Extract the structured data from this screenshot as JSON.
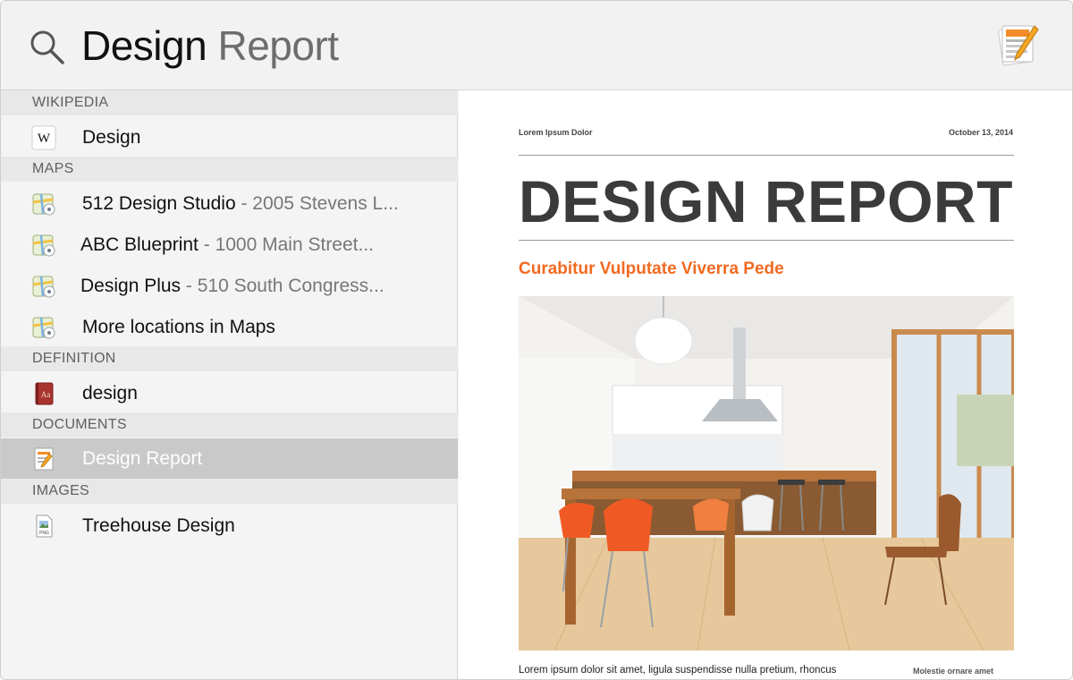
{
  "search": {
    "typed": "Design",
    "completion": " Report",
    "icon": "search-icon"
  },
  "app": {
    "icon": "pages-app-icon"
  },
  "sections": {
    "wikipedia": "WIKIPEDIA",
    "maps": "MAPS",
    "definition": "DEFINITION",
    "documents": "DOCUMENTS",
    "images": "IMAGES"
  },
  "results": {
    "wikipedia": [
      {
        "title": "Design",
        "subtitle": "",
        "icon": "wikipedia-icon"
      }
    ],
    "maps": [
      {
        "title": "512 Design Studio",
        "subtitle": " - 2005 Stevens L...",
        "icon": "maps-icon"
      },
      {
        "title": "ABC Blueprint",
        "subtitle": " - 1000 Main Street...",
        "icon": "maps-icon"
      },
      {
        "title": "Design Plus",
        "subtitle": " - 510 South Congress...",
        "icon": "maps-icon"
      },
      {
        "title": "More locations in Maps",
        "subtitle": "",
        "icon": "maps-icon"
      }
    ],
    "definition": [
      {
        "title": "design",
        "subtitle": "",
        "icon": "dictionary-icon"
      }
    ],
    "documents": [
      {
        "title": "Design Report",
        "subtitle": "",
        "icon": "pages-document-icon",
        "selected": true
      }
    ],
    "images": [
      {
        "title": "Treehouse Design",
        "subtitle": "",
        "icon": "png-file-icon"
      }
    ]
  },
  "preview": {
    "header_left": "Lorem Ipsum Dolor",
    "header_right": "October 13, 2014",
    "title": "DESIGN REPORT",
    "subtitle": "Curabitur Vulputate Viverra Pede",
    "body": "Lorem ipsum dolor sit amet, ligula suspendisse nulla pretium, rhoncus",
    "caption": "Molestie ornare amet",
    "accent_color": "#f26a21",
    "image": "kitchen-dining-room-photo"
  }
}
